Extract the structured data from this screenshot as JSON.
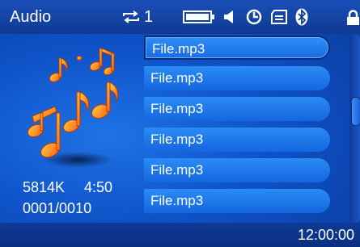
{
  "status": {
    "title": "Audio",
    "repeat_count": "1"
  },
  "info": {
    "file_size": "5814K",
    "duration": "4:50",
    "track_index": "0001/0010"
  },
  "files": [
    {
      "label": "File.mp3",
      "selected": true
    },
    {
      "label": "File.mp3",
      "selected": false
    },
    {
      "label": "File.mp3",
      "selected": false
    },
    {
      "label": "File.mp3",
      "selected": false
    },
    {
      "label": "File.mp3",
      "selected": false
    },
    {
      "label": "File.mp3",
      "selected": false
    }
  ],
  "clock": "12:00:00",
  "icons": [
    "repeat-icon",
    "battery-icon",
    "speaker-icon",
    "clock-icon",
    "card-icon",
    "bluetooth-icon",
    "lock-icon",
    "music-notes-icon"
  ],
  "colors": {
    "background": "#0f52c8",
    "item": "#1e78ec",
    "text": "#ffffff",
    "notes": "#ff8a1e"
  }
}
